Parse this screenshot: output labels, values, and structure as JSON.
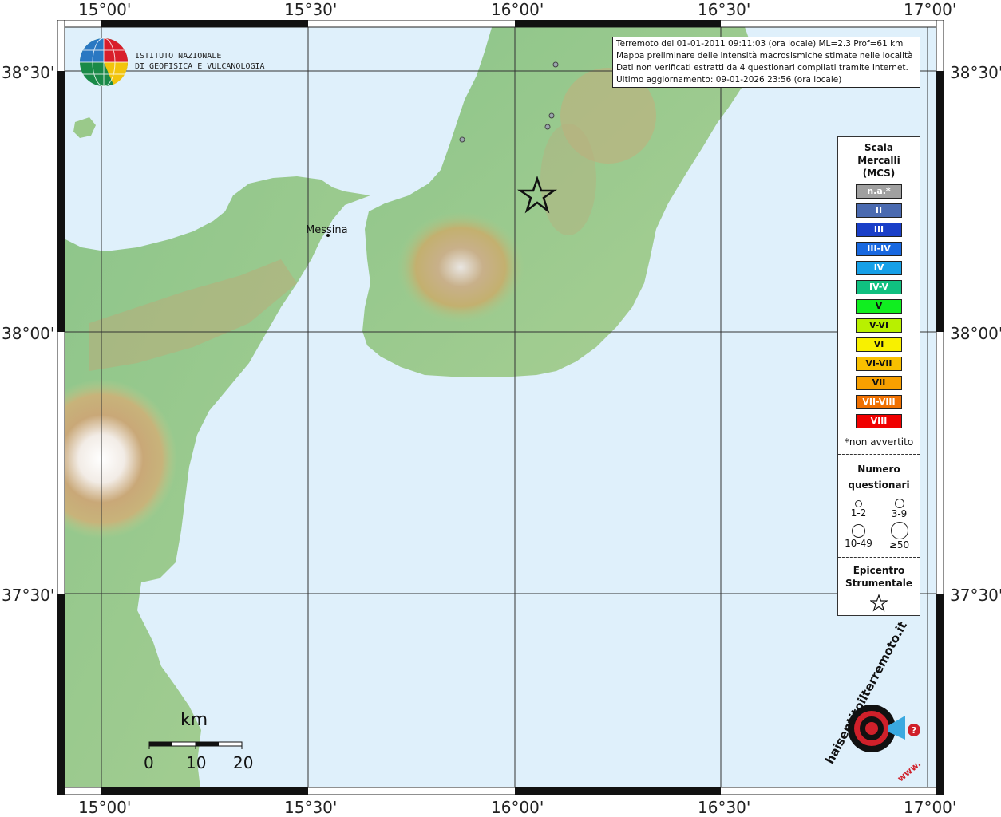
{
  "axes": {
    "lon_labels": [
      "15°00'",
      "15°30'",
      "16°00'",
      "16°30'",
      "17°00'"
    ],
    "lat_labels": [
      "38°30'",
      "38°00'",
      "37°30'"
    ]
  },
  "header": {
    "line1": "Terremoto del 01-01-2011 09:11:03 (ora locale) ML=2.3 Prof=61 km",
    "line2": "Mappa preliminare delle intensità macrosismiche stimate nelle località",
    "line3": "Dati non verificati estratti da 4 questionari compilati tramite Internet.",
    "line4": "Ultimo aggiornamento: 09-01-2026 23:56 (ora locale)"
  },
  "logo": {
    "line1": "ISTITUTO NAZIONALE",
    "line2": "DI GEOFISICA E VULCANOLOGIA"
  },
  "places": {
    "messina": "Messina"
  },
  "legend": {
    "title_line1": "Scala",
    "title_line2": "Mercalli",
    "title_line3": "(MCS)",
    "intensities": [
      {
        "label": "n.a.*",
        "color": "#a0a0a0"
      },
      {
        "label": "II",
        "color": "#4a6ab0"
      },
      {
        "label": "III",
        "color": "#1a3fc8"
      },
      {
        "label": "III-IV",
        "color": "#1868e0"
      },
      {
        "label": "IV",
        "color": "#16a0e8"
      },
      {
        "label": "IV-V",
        "color": "#10c080"
      },
      {
        "label": "V",
        "color": "#10ee20"
      },
      {
        "label": "V-VI",
        "color": "#b8f000"
      },
      {
        "label": "VI",
        "color": "#f8f000"
      },
      {
        "label": "VI-VII",
        "color": "#f8c000"
      },
      {
        "label": "VII",
        "color": "#f8a000"
      },
      {
        "label": "VII-VIII",
        "color": "#f07000"
      },
      {
        "label": "VIII",
        "color": "#f00000"
      }
    ],
    "note": "*non avvertito",
    "questionari_line1": "Numero",
    "questionari_line2": "questionari",
    "sizes": [
      "1-2",
      "3-9",
      "10-49",
      "≥50"
    ],
    "epicentro_line1": "Epicentro",
    "epicentro_line2": "Strumentale"
  },
  "scalebar": {
    "unit": "km",
    "ticks": [
      "0",
      "10",
      "20"
    ]
  },
  "badge": {
    "text": "haisentitoilterremoto.it",
    "prefix": "www."
  }
}
